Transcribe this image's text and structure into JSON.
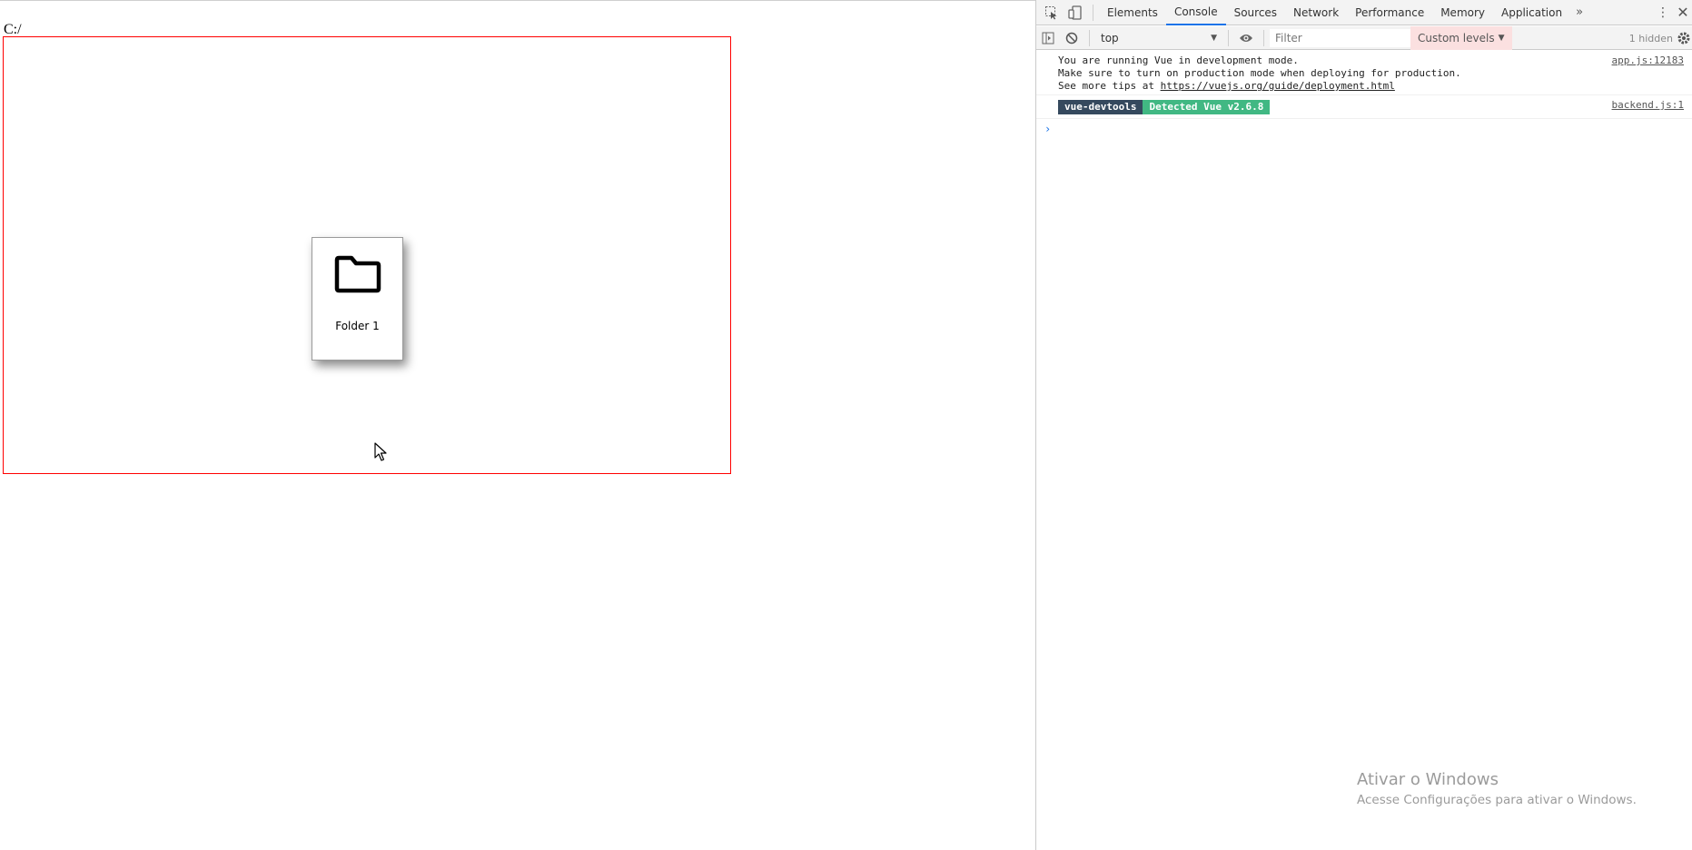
{
  "page": {
    "path_label": "C:/",
    "folder": {
      "name": "Folder 1",
      "icon": "folder-icon"
    }
  },
  "devtools": {
    "tabs": [
      "Elements",
      "Console",
      "Sources",
      "Network",
      "Performance",
      "Memory",
      "Application"
    ],
    "active_tab": "Console",
    "more_tabs_glyph": "»",
    "toolbar": {
      "context": "top",
      "filter_placeholder": "Filter",
      "levels_label": "Custom levels",
      "hidden_count": "1 hidden"
    },
    "console": {
      "messages": [
        {
          "line1": "You are running Vue in development mode.",
          "line2": "Make sure to turn on production mode when deploying for production.",
          "line3_prefix": "See more tips at ",
          "line3_link": "https://vuejs.org/guide/deployment.html",
          "source": "app.js:12183"
        },
        {
          "badge_a": "vue-devtools",
          "badge_b": "Detected Vue v2.6.8",
          "source": "backend.js:1"
        }
      ],
      "prompt": "›"
    }
  },
  "watermark": {
    "title": "Ativar o Windows",
    "subtitle": "Acesse Configurações para ativar o Windows."
  },
  "colors": {
    "drop_zone_border": "#ff0000",
    "active_tab_underline": "#1a73e8",
    "vue_badge_dark": "#35495e",
    "vue_badge_green": "#41b883",
    "levels_bg": "#fbe0e0"
  }
}
